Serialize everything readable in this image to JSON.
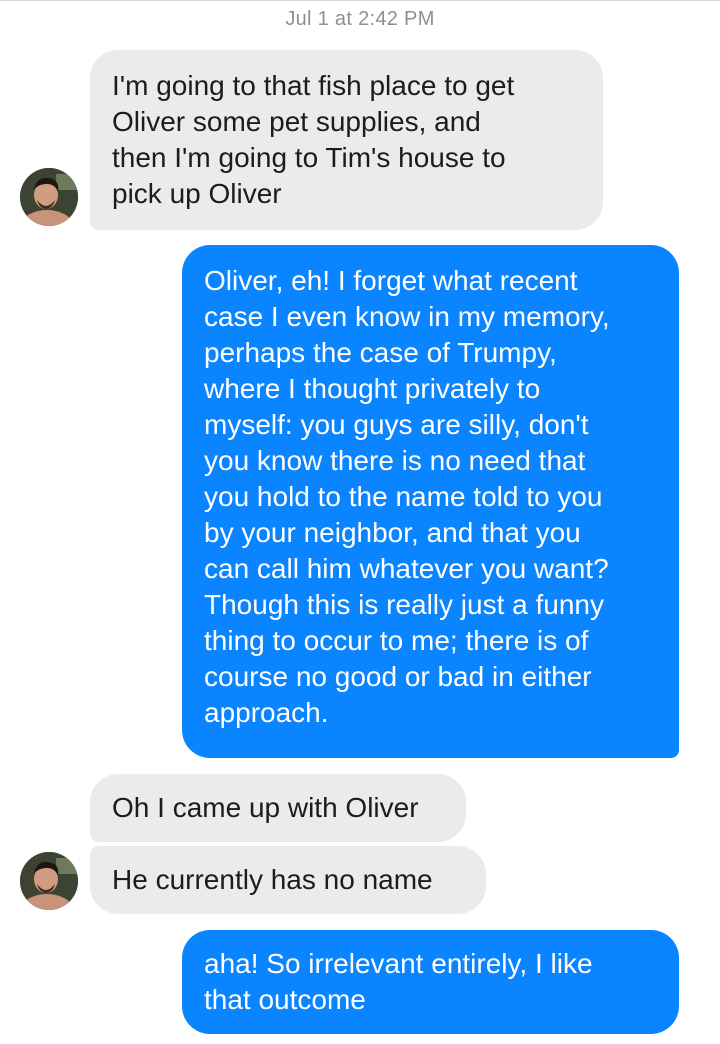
{
  "conversation": {
    "timestamp": "Jul 1 at 2:42 PM",
    "messages": [
      {
        "direction": "incoming",
        "text": "I'm going to that fish place to get\nOliver some pet supplies, and\nthen I'm going to Tim's house to\npick up Oliver"
      },
      {
        "direction": "outgoing",
        "text": "Oliver, eh! I forget what recent\ncase I even know in my memory,\nperhaps the case of Trumpy,\nwhere I thought privately to\nmyself: you guys are silly, don't\nyou know there is no need that\nyou hold to the name told to you\nby your neighbor, and that you\ncan call him whatever you want?\nThough this is really just a funny\nthing to occur to me; there is of\ncourse no good or bad in either\napproach."
      },
      {
        "direction": "incoming",
        "text": "Oh I came up with Oliver"
      },
      {
        "direction": "incoming",
        "text": "He currently has no name"
      },
      {
        "direction": "outgoing",
        "text": "aha! So irrelevant entirely, I like\nthat outcome"
      }
    ]
  },
  "colors": {
    "incoming_bubble": "#ebebeb",
    "outgoing_bubble": "#0a84ff",
    "timestamp_text": "#8e8e93"
  },
  "icons": {
    "contact_avatar": "contact-avatar-photo"
  }
}
